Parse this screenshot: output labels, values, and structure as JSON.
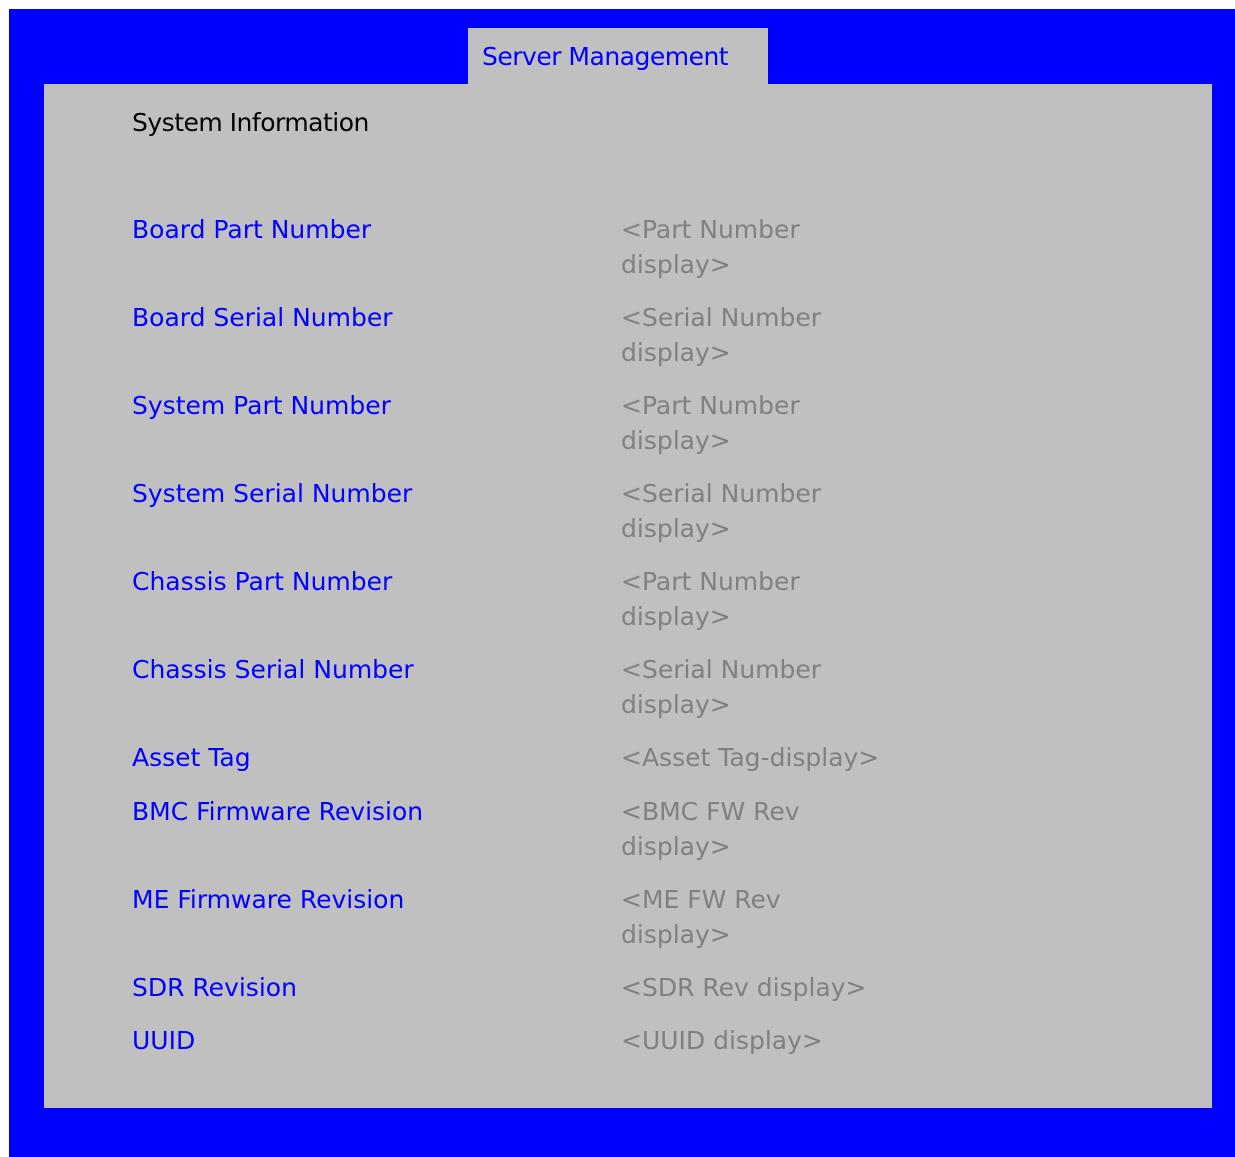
{
  "tab": {
    "label": "Server Management"
  },
  "page": {
    "title": "System Information"
  },
  "rows": [
    {
      "label": "Board Part Number",
      "value": "<Part Number display>"
    },
    {
      "label": "Board Serial Number",
      "value": "<Serial Number display>"
    },
    {
      "label": "System Part Number",
      "value": "<Part Number display>"
    },
    {
      "label": "System Serial Number",
      "value": "<Serial Number display>"
    },
    {
      "label": "Chassis Part Number",
      "value": "<Part Number display>"
    },
    {
      "label": "Chassis Serial Number",
      "value": "<Serial Number display>"
    },
    {
      "label": "Asset Tag",
      "value": "<Asset Tag-display>"
    },
    {
      "label": "BMC Firmware Revision",
      "value": "<BMC FW Rev display>"
    },
    {
      "label": "ME Firmware Revision",
      "value": "<ME FW Rev display>"
    },
    {
      "label": "SDR Revision",
      "value": "<SDR Rev display>"
    },
    {
      "label": "UUID",
      "value": "<UUID display>"
    }
  ],
  "colors": {
    "frame": "#0000ff",
    "panel": "#c0c0c0",
    "label": "#0000ff",
    "value": "#808080",
    "title": "#000000"
  }
}
